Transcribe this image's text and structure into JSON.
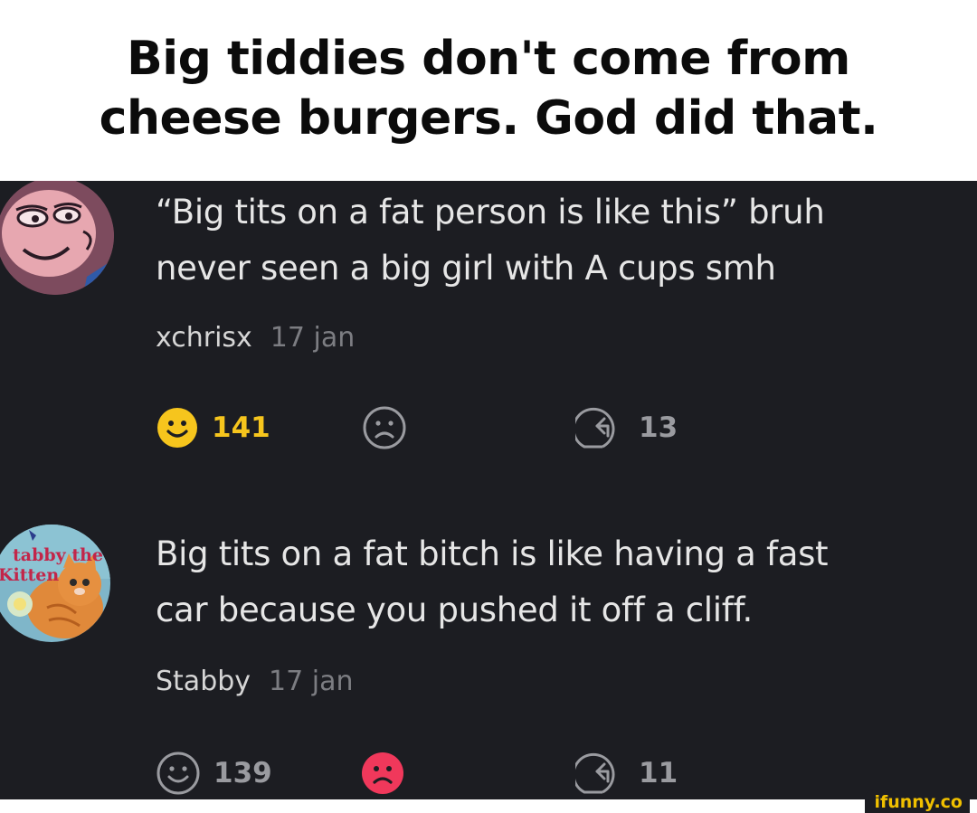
{
  "caption": {
    "line1": "Big tiddies don't come from",
    "line2": "cheese burgers. God did that."
  },
  "comments": [
    {
      "avatar_icon": "cartoon-face-avatar-icon",
      "text_line1": "“Big tits on a fat person is like this” bruh",
      "text_line2": "never seen a big girl with A cups smh",
      "username": "xchrisx",
      "date": "17 jan",
      "smile_count": "141",
      "smile_active": true,
      "frown_count": "",
      "frown_active": false,
      "reply_count": "13"
    },
    {
      "avatar_icon": "kitten-book-avatar-icon",
      "text_line1": "Big tits on a fat bitch is like having a fast",
      "text_line2": "car because you pushed it off a cliff.",
      "username": "Stabby",
      "date": "17 jan",
      "smile_count": "139",
      "smile_active": false,
      "frown_count": "",
      "frown_active": true,
      "reply_count": "11"
    }
  ],
  "avatar2_text": {
    "line1": "tabby the",
    "line2": "Kitten"
  },
  "watermark": "ifunny.co",
  "colors": {
    "background": "#1c1d22",
    "text": "#e6e6e6",
    "muted": "#7c7d82",
    "smile_active": "#f6c51d",
    "frown_active": "#f0385b",
    "icon_inactive": "#9a9ba0"
  }
}
